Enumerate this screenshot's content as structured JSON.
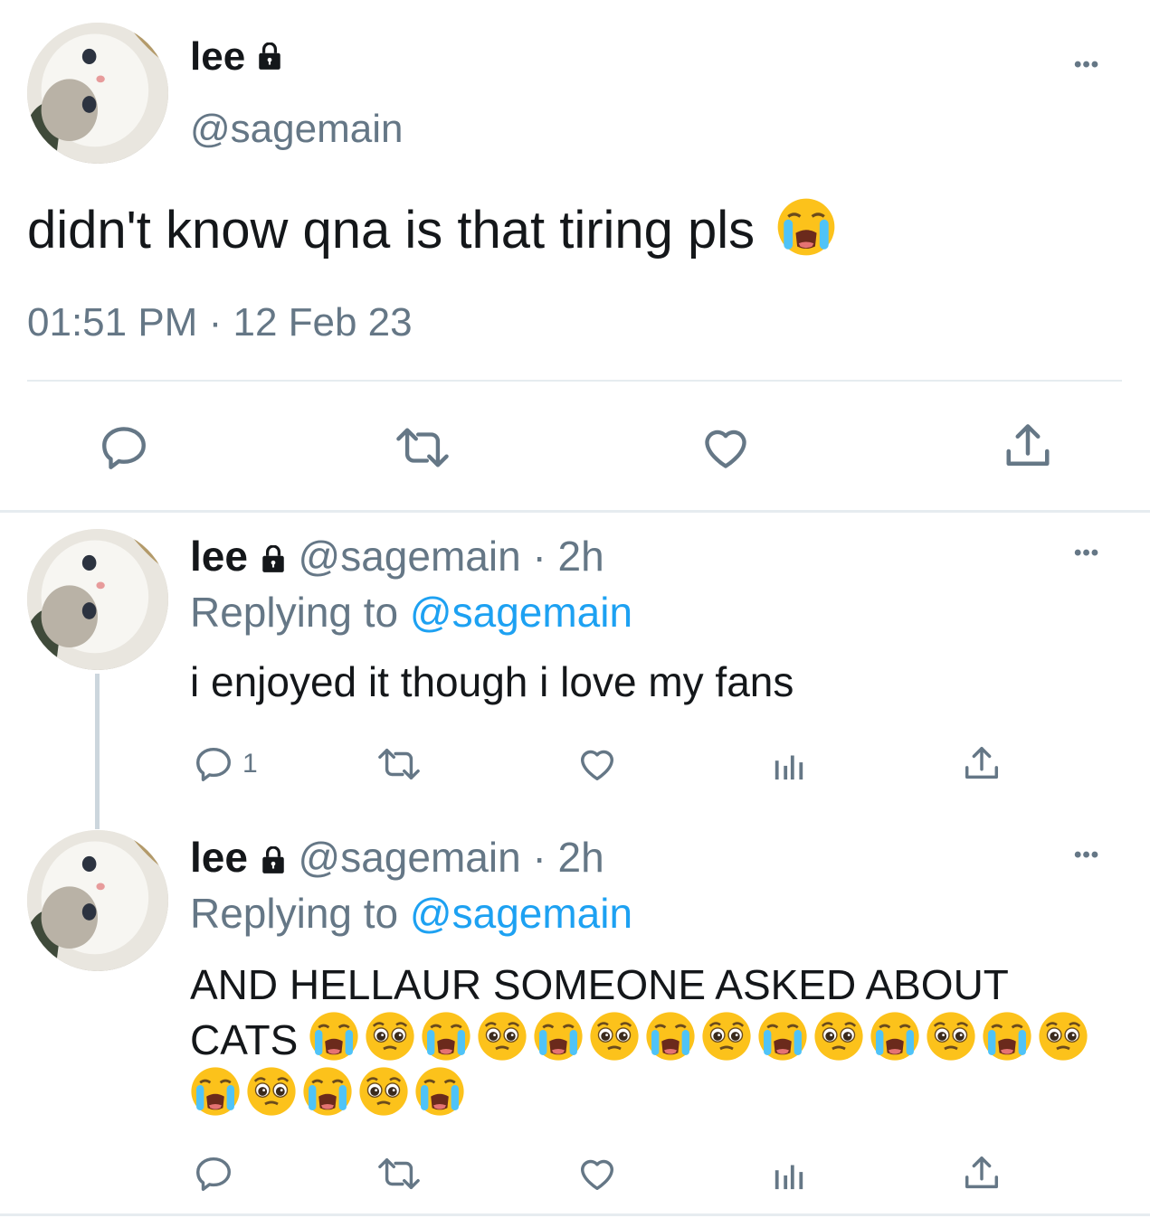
{
  "colors": {
    "text": "#14171a",
    "secondary": "#657786",
    "accent": "#1da1f2",
    "divider": "#e6ecf0"
  },
  "main_tweet": {
    "name": "lee",
    "handle": "@sagemain",
    "text": "didn't know qna is that tiring pls",
    "emoji": "loudly-crying-face",
    "time": "01:51 PM",
    "separator": "·",
    "date": "12 Feb 23",
    "more": "•••",
    "actions": [
      "reply-icon",
      "retweet-icon",
      "like-icon",
      "share-icon"
    ]
  },
  "replies": [
    {
      "name": "lee",
      "handle": "@sagemain",
      "time": "· 2h",
      "replying_prefix": "Replying to",
      "replying_handle": "@sagemain",
      "text": "i enjoyed it though i love my fans",
      "reply_count": "1",
      "more": "•••"
    },
    {
      "name": "lee",
      "handle": "@sagemain",
      "time": "· 2h",
      "replying_prefix": "Replying to",
      "replying_handle": "@sagemain",
      "text_line1": "AND HELLAUR SOMEONE ASKED ABOUT",
      "text_line2": "CATS",
      "emoji_sequence": [
        "crying",
        "pleading",
        "crying",
        "pleading",
        "crying",
        "pleading",
        "crying",
        "pleading",
        "crying",
        "pleading",
        "crying",
        "pleading",
        "crying",
        "pleading",
        "crying",
        "pleading",
        "crying",
        "pleading",
        "crying"
      ],
      "more": "•••"
    }
  ]
}
